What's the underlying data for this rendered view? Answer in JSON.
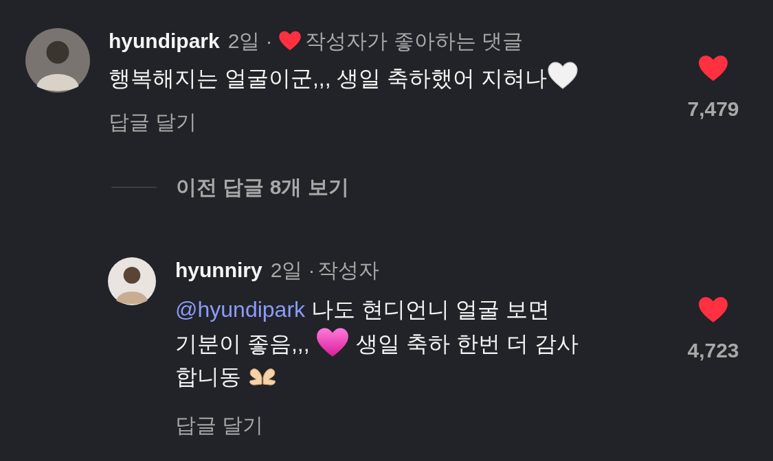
{
  "comments": [
    {
      "kind": "comment",
      "username": "hyundipark",
      "meta": [
        {
          "kind": "time",
          "text": "2일"
        },
        {
          "kind": "dot",
          "text": "·"
        },
        {
          "kind": "liked",
          "text": "작성자가 좋아하는 댓글"
        }
      ],
      "lines": [
        [
          {
            "kind": "text",
            "text": "행복해지는 얼굴이군,,, 생일 축하했어 지혀나"
          },
          {
            "kind": "whiteheart"
          }
        ]
      ],
      "reply_label": "답글 달기",
      "liked": true,
      "likes": "7,479"
    },
    {
      "kind": "more",
      "view_replies": "이전 답글 8개 보기"
    },
    {
      "kind": "reply",
      "username": "hyunniry",
      "meta": [
        {
          "kind": "time",
          "text": "2일"
        },
        {
          "kind": "dot",
          "text": "·"
        },
        {
          "kind": "plain",
          "text": "작성자"
        }
      ],
      "lines": [
        [
          {
            "kind": "mention",
            "text": "@hyundipark"
          },
          {
            "kind": "text",
            "text": " 나도 현디언니 얼굴 보면"
          }
        ],
        [
          {
            "kind": "text",
            "text": "기분이 좋음,,, "
          },
          {
            "kind": "pinkheart"
          },
          {
            "kind": "text",
            "text": " 생일 축하 한번 더 감사"
          }
        ],
        [
          {
            "kind": "text",
            "text": "합니동 "
          },
          {
            "kind": "hands"
          }
        ]
      ],
      "reply_label": "답글 달기",
      "liked": true,
      "likes": "4,723"
    }
  ]
}
